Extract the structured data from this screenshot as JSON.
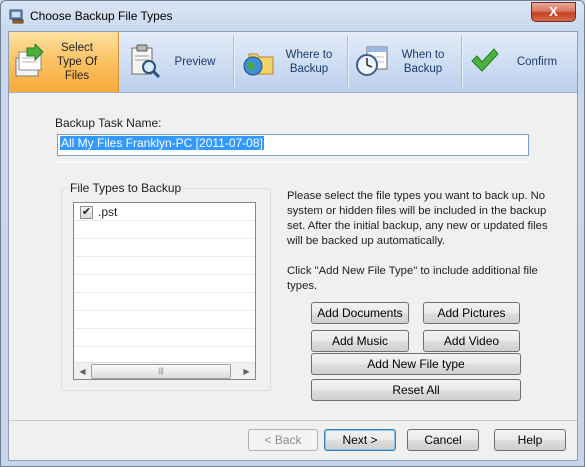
{
  "window": {
    "title": "Choose Backup File Types",
    "close_label": "X"
  },
  "steps": [
    {
      "label": "Select Type Of Files",
      "icon": "select-file-type-icon",
      "active": true
    },
    {
      "label": "Preview",
      "icon": "clipboard-magnifier-icon",
      "active": false
    },
    {
      "label": "Where to Backup",
      "icon": "globe-folder-icon",
      "active": false
    },
    {
      "label": "When to Backup",
      "icon": "clock-calendar-icon",
      "active": false
    },
    {
      "label": "Confirm",
      "icon": "green-check-icon",
      "active": false
    }
  ],
  "form": {
    "task_name_label": "Backup Task Name:",
    "task_name_value": "All My Files  Franklyn-PC [2011-07-08]"
  },
  "file_types": {
    "group_label": "File Types to Backup",
    "items": [
      {
        "label": ".pst",
        "checked": true
      }
    ]
  },
  "description": {
    "paragraph1": "Please select the file types you want to back up. No system or hidden files will be included in the backup set. After the initial backup, any new or updated files will be backed up automatically.",
    "paragraph2": "Click \"Add New File Type\" to include additional file types."
  },
  "buttons": {
    "add_documents": "Add Documents",
    "add_pictures": "Add Pictures",
    "add_music": "Add Music",
    "add_video": "Add Video",
    "add_new_file_type": "Add New File type",
    "reset_all": "Reset All"
  },
  "footer": {
    "back": "< Back",
    "next": "Next >",
    "cancel": "Cancel",
    "help": "Help"
  }
}
